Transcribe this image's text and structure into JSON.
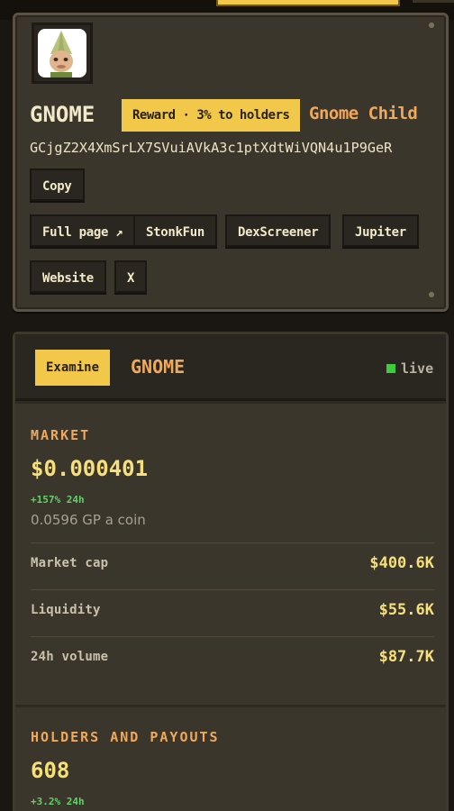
{
  "token": {
    "ticker": "GNOME",
    "reward_badge": "Reward · 3% to holders",
    "name": "Gnome Child",
    "address": "GCjgZ2X4XmSrLX7SVuiAVkA3c1ptXdtWiVQN4u1P9GeR",
    "copy_label": "Copy",
    "links": [
      "Full page ↗",
      "StonkFun",
      "DexScreener",
      "Jupiter",
      "Website",
      "X"
    ]
  },
  "panel": {
    "examine_label": "Examine",
    "title": "GNOME",
    "live_label": "live",
    "market": {
      "label": "MARKET",
      "price": "$0.000401",
      "change": "+157% 24h",
      "gp": "0.0596 GP a coin",
      "rows": [
        {
          "label": "Market cap",
          "value": "$400.6K"
        },
        {
          "label": "Liquidity",
          "value": "$55.6K"
        },
        {
          "label": "24h volume",
          "value": "$87.7K"
        }
      ]
    },
    "holders": {
      "label": "HOLDERS AND PAYOUTS",
      "count": "608",
      "change": "+3.2% 24h"
    }
  },
  "colors": {
    "accent_yellow": "#f2c84b",
    "accent_orange": "#f0a85a",
    "value_yellow": "#f7e07a",
    "positive_green": "#63d06a",
    "live_green": "#3ecb3e"
  }
}
